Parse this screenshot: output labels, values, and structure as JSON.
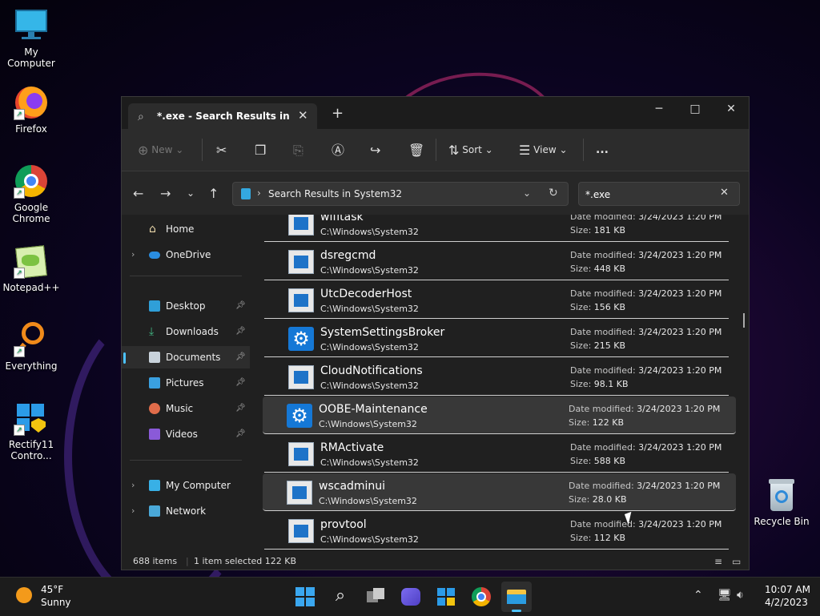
{
  "desktop": {
    "icons": [
      {
        "label": "My Computer"
      },
      {
        "label": "Firefox"
      },
      {
        "label": "Google Chrome"
      },
      {
        "label": "Notepad++"
      },
      {
        "label": "Everything"
      },
      {
        "label": "Rectify11 Contro..."
      },
      {
        "label": "Recycle Bin"
      }
    ]
  },
  "explorer": {
    "tab_title": "*.exe - Search Results in Syste",
    "toolbar": {
      "new": "New",
      "sort": "Sort",
      "view": "View",
      "more": "..."
    },
    "address": {
      "path": "Search Results in System32"
    },
    "search": {
      "value": "*.exe"
    },
    "sidebar": {
      "items": [
        {
          "label": "Home"
        },
        {
          "label": "OneDrive"
        },
        {
          "label": "Desktop"
        },
        {
          "label": "Downloads"
        },
        {
          "label": "Documents"
        },
        {
          "label": "Pictures"
        },
        {
          "label": "Music"
        },
        {
          "label": "Videos"
        },
        {
          "label": "My Computer"
        },
        {
          "label": "Network"
        }
      ]
    },
    "labels": {
      "date_modified": "Date modified:",
      "size": "Size:"
    },
    "files": [
      {
        "name": "wifitask",
        "path": "C:\\Windows\\System32",
        "date": "3/24/2023 1:20 PM",
        "size": "181 KB",
        "icon": "exe"
      },
      {
        "name": "dsregcmd",
        "path": "C:\\Windows\\System32",
        "date": "3/24/2023 1:20 PM",
        "size": "448 KB",
        "icon": "exe"
      },
      {
        "name": "UtcDecoderHost",
        "path": "C:\\Windows\\System32",
        "date": "3/24/2023 1:20 PM",
        "size": "156 KB",
        "icon": "exe"
      },
      {
        "name": "SystemSettingsBroker",
        "path": "C:\\Windows\\System32",
        "date": "3/24/2023 1:20 PM",
        "size": "215 KB",
        "icon": "gear"
      },
      {
        "name": "CloudNotifications",
        "path": "C:\\Windows\\System32",
        "date": "3/24/2023 1:20 PM",
        "size": "98.1 KB",
        "icon": "exe"
      },
      {
        "name": "OOBE-Maintenance",
        "path": "C:\\Windows\\System32",
        "date": "3/24/2023 1:20 PM",
        "size": "122 KB",
        "icon": "gear"
      },
      {
        "name": "RMActivate",
        "path": "C:\\Windows\\System32",
        "date": "3/24/2023 1:20 PM",
        "size": "588 KB",
        "icon": "exe"
      },
      {
        "name": "wscadminui",
        "path": "C:\\Windows\\System32",
        "date": "3/24/2023 1:20 PM",
        "size": "28.0 KB",
        "icon": "exe"
      },
      {
        "name": "provtool",
        "path": "C:\\Windows\\System32",
        "date": "3/24/2023 1:20 PM",
        "size": "112 KB",
        "icon": "exe"
      }
    ],
    "status": {
      "item_count": "688 items",
      "selection": "1 item selected  122 KB"
    }
  },
  "taskbar": {
    "weather_temp": "45°F",
    "weather_desc": "Sunny",
    "time": "10:07 AM",
    "date": "4/2/2023"
  }
}
